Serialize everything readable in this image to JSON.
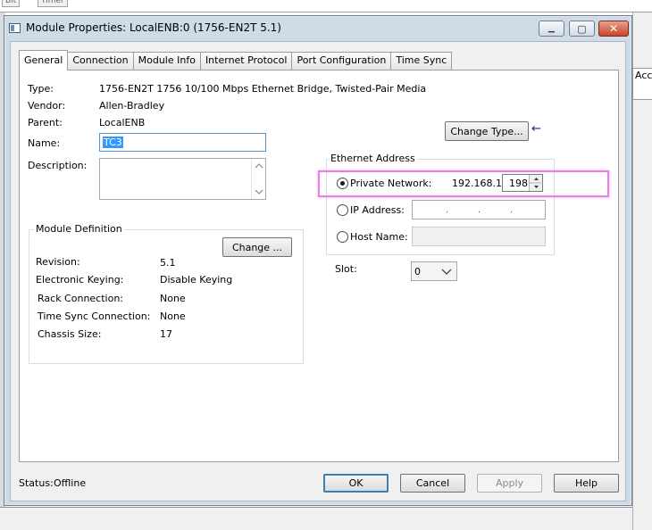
{
  "background": {
    "toolbar_items": [
      "Bit",
      "Timer"
    ],
    "right_pane_text": "Acce"
  },
  "window": {
    "title": "Module Properties: LocalENB:0 (1756-EN2T 5.1)",
    "close_symbol": "✕",
    "minimize_symbol": "▁",
    "maximize_symbol": "▢"
  },
  "tabs": [
    {
      "label": "General",
      "active": true
    },
    {
      "label": "Connection"
    },
    {
      "label": "Module Info"
    },
    {
      "label": "Internet Protocol"
    },
    {
      "label": "Port Configuration"
    },
    {
      "label": "Time Sync"
    }
  ],
  "general": {
    "type_label": "Type:",
    "type_value": "1756-EN2T 1756 10/100 Mbps Ethernet Bridge, Twisted-Pair Media",
    "vendor_label": "Vendor:",
    "vendor_value": "Allen-Bradley",
    "parent_label": "Parent:",
    "parent_value": "LocalENB",
    "name_label": "Name:",
    "name_value": "TC3",
    "description_label": "Description:",
    "description_value": "",
    "change_type_label": "Change Type...",
    "change_type_arrow": "←"
  },
  "module_definition": {
    "title": "Module Definition",
    "change_label": "Change ...",
    "rows": [
      {
        "label": "Revision:",
        "value": "5.1"
      },
      {
        "label": "Electronic Keying:",
        "value": "Disable Keying"
      },
      {
        "label": "Rack Connection:",
        "value": "None"
      },
      {
        "label": "Time Sync Connection:",
        "value": "None"
      },
      {
        "label": "Chassis Size:",
        "value": "17"
      }
    ]
  },
  "ethernet": {
    "title": "Ethernet Address",
    "private_label": "Private Network:",
    "private_prefix": "192.168.1.",
    "private_last_octet": "198",
    "ip_label": "IP Address:",
    "host_label": "Host Name:",
    "selected": "private"
  },
  "slot": {
    "label": "Slot:",
    "value": "0"
  },
  "footer": {
    "status_label": "Status:",
    "status_value": "Offline",
    "ok": "OK",
    "cancel": "Cancel",
    "apply": "Apply",
    "help": "Help"
  }
}
